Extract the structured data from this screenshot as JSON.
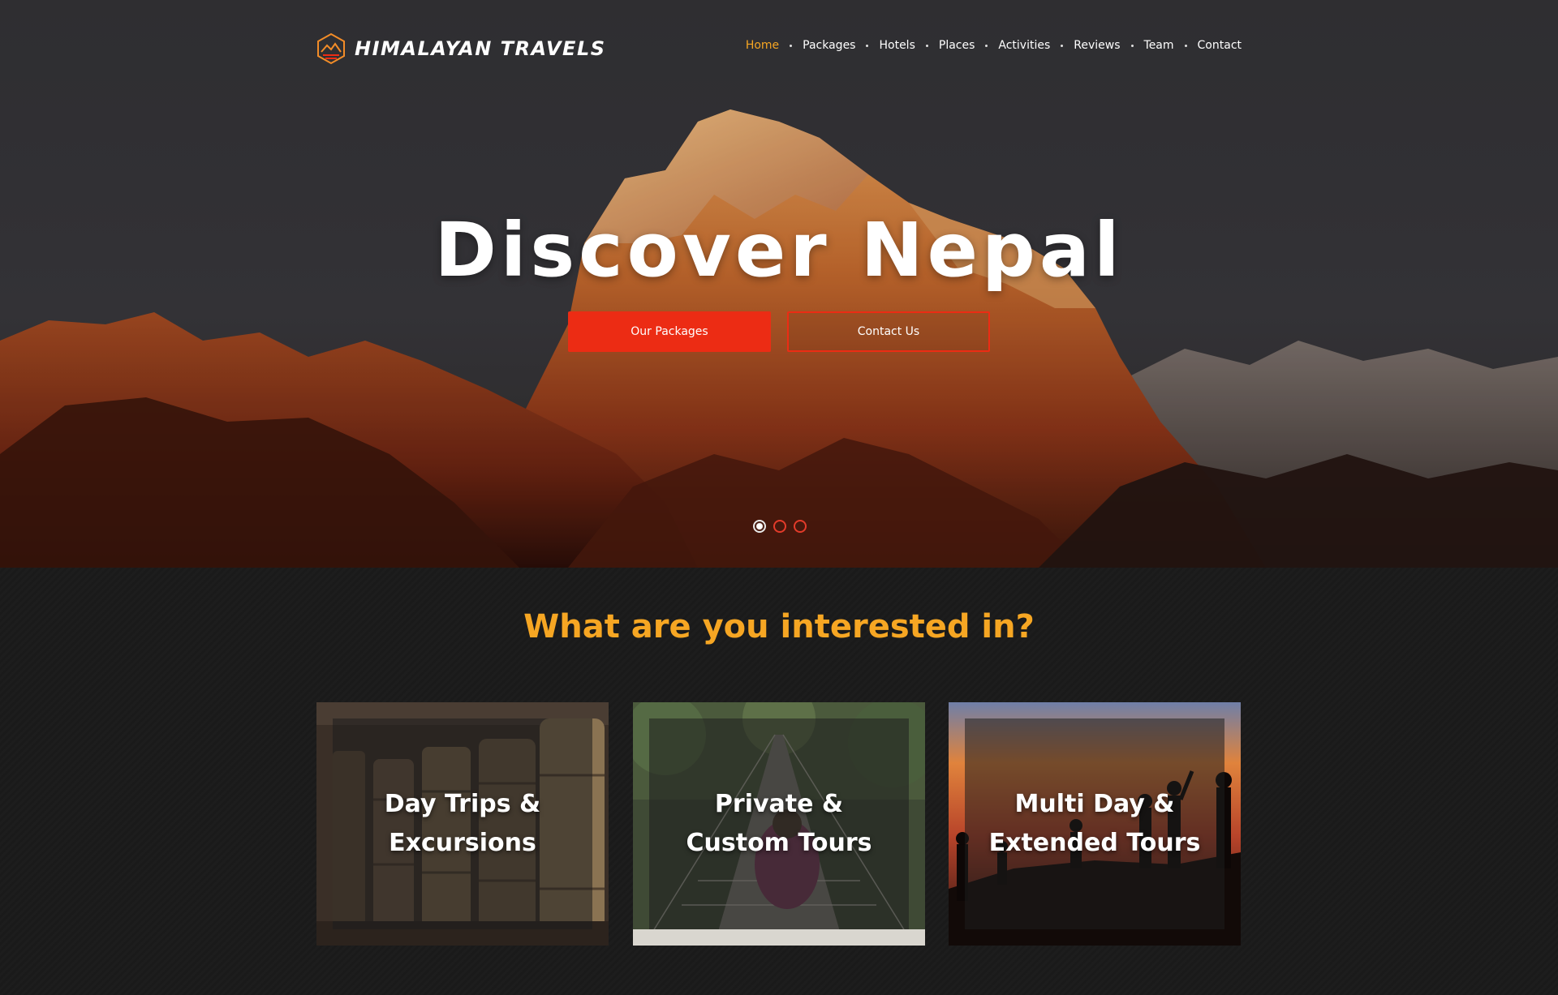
{
  "brand": {
    "name": "HIMALAYAN TRAVELS",
    "logo_icon": "mountain-hexagon-icon",
    "accent": "#f6a623",
    "primary": "#ec2c14"
  },
  "nav": {
    "items": [
      {
        "label": "Home",
        "active": true
      },
      {
        "label": "Packages"
      },
      {
        "label": "Hotels"
      },
      {
        "label": "Places"
      },
      {
        "label": "Activities"
      },
      {
        "label": "Reviews"
      },
      {
        "label": "Team"
      },
      {
        "label": "Contact"
      }
    ]
  },
  "hero": {
    "title": "Discover Nepal",
    "primary_button": "Our Packages",
    "secondary_button": "Contact Us",
    "slide_count": 3,
    "active_slide": 1
  },
  "interests": {
    "title": "What are you interested in?",
    "cards": [
      {
        "line1": "Day Trips &",
        "line2": "Excursions",
        "image": "prayer-wheels"
      },
      {
        "line1": "Private &",
        "line2": "Custom Tours",
        "image": "suspension-bridge-hiker"
      },
      {
        "line1": "Multi Day &",
        "line2": "Extended Tours",
        "image": "sunset-silhouettes"
      }
    ]
  }
}
